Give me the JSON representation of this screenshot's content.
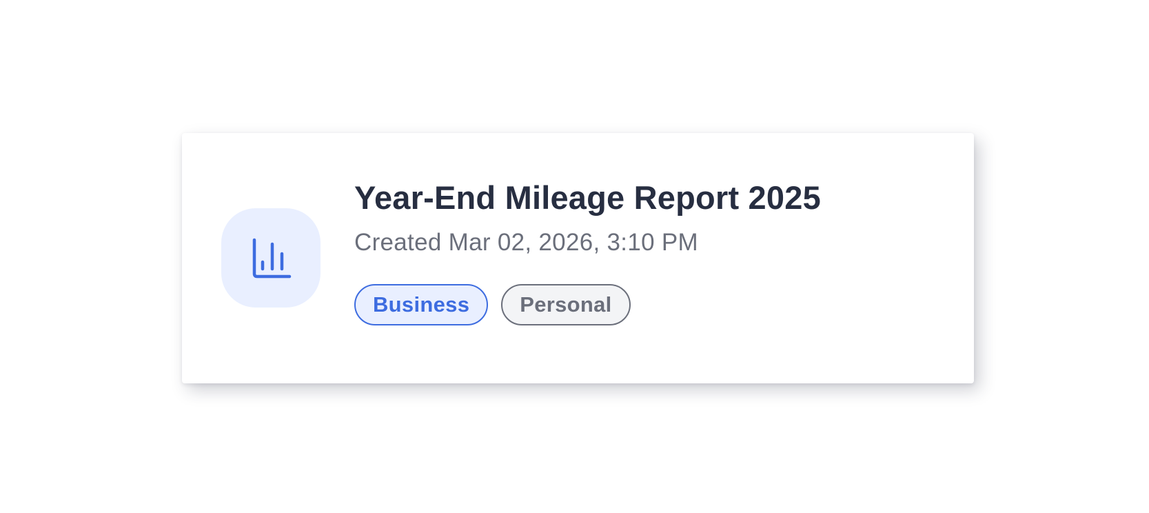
{
  "report": {
    "title": "Year-End Mileage Report 2025",
    "created": "Created Mar 02, 2026, 3:10 PM",
    "icon": "bar-chart-icon",
    "tags": [
      {
        "label": "Business",
        "color": "#3d6ce0"
      },
      {
        "label": "Personal",
        "color": "#6b6f7b"
      }
    ]
  },
  "colors": {
    "accent": "#3d6ce0",
    "accent_bg": "#e9efff",
    "title": "#272e41",
    "muted": "#6b6f7b"
  }
}
